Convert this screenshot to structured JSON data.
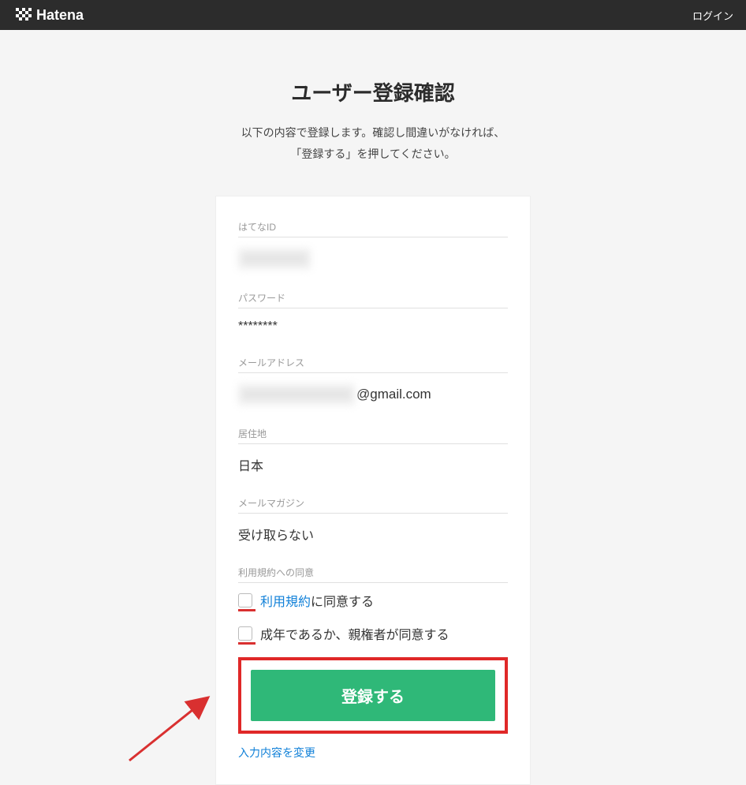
{
  "header": {
    "brand": "Hatena",
    "login_label": "ログイン"
  },
  "page": {
    "title": "ユーザー登録確認",
    "subtitle_line1": "以下の内容で登録します。確認し間違いがなければ、",
    "subtitle_line2": "「登録する」を押してください。"
  },
  "fields": {
    "hatena_id": {
      "label": "はてなID",
      "value": ""
    },
    "password": {
      "label": "パスワード",
      "value": "********"
    },
    "email": {
      "label": "メールアドレス",
      "local": "",
      "domain": "@gmail.com"
    },
    "residence": {
      "label": "居住地",
      "value": "日本"
    },
    "newsletter": {
      "label": "メールマガジン",
      "value": "受け取らない"
    },
    "consent": {
      "label": "利用規約への同意",
      "terms_link": "利用規約",
      "terms_suffix": "に同意する",
      "adult_text": "成年であるか、親権者が同意する"
    }
  },
  "actions": {
    "submit": "登録する",
    "edit": "入力内容を変更"
  }
}
